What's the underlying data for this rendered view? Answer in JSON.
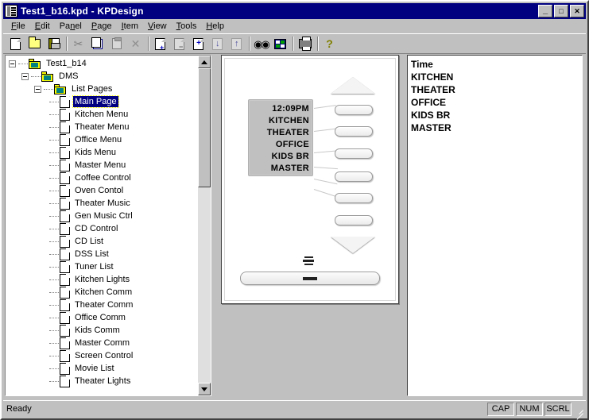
{
  "window": {
    "title": "Test1_b16.kpd - KPDesign",
    "icon": "application-icon",
    "minimize_label": "_",
    "maximize_label": "□",
    "close_label": "✕"
  },
  "menubar": {
    "items": [
      {
        "label": "File",
        "accel": "F"
      },
      {
        "label": "Edit",
        "accel": "E"
      },
      {
        "label": "Panel",
        "accel": "n"
      },
      {
        "label": "Page",
        "accel": "P"
      },
      {
        "label": "Item",
        "accel": "I"
      },
      {
        "label": "View",
        "accel": "V"
      },
      {
        "label": "Tools",
        "accel": "T"
      },
      {
        "label": "Help",
        "accel": "H"
      }
    ]
  },
  "toolbar": {
    "buttons": [
      {
        "name": "new-file-icon",
        "tip": "New"
      },
      {
        "name": "open-folder-icon",
        "tip": "Open"
      },
      {
        "name": "save-disk-icon",
        "tip": "Save"
      },
      {
        "name": "cut-scissors-icon",
        "tip": "Cut"
      },
      {
        "name": "copy-icon",
        "tip": "Copy"
      },
      {
        "name": "paste-clipboard-icon",
        "tip": "Paste"
      },
      {
        "name": "delete-x-icon",
        "tip": "Delete"
      },
      {
        "name": "add-page-icon",
        "tip": "Add Page"
      },
      {
        "name": "remove-page-icon",
        "tip": "Remove Page"
      },
      {
        "name": "new-page-plus-icon",
        "tip": "New Page"
      },
      {
        "name": "move-down-icon",
        "tip": "Move Down"
      },
      {
        "name": "move-up-icon",
        "tip": "Move Up"
      },
      {
        "name": "find-binoculars-icon",
        "tip": "Find"
      },
      {
        "name": "grid-icon",
        "tip": "Grid"
      },
      {
        "name": "print-icon",
        "tip": "Print"
      },
      {
        "name": "help-question-icon",
        "tip": "Help"
      }
    ]
  },
  "tree": {
    "root": {
      "label": "Test1_b14",
      "icon": "folder-icon",
      "expanded": true
    },
    "level2": {
      "label": "DMS",
      "icon": "folder-icon",
      "expanded": true
    },
    "level3": {
      "label": "List Pages",
      "icon": "folder-icon",
      "expanded": true
    },
    "pages": [
      {
        "label": "Main Page",
        "selected": true
      },
      {
        "label": "Kitchen Menu",
        "selected": false
      },
      {
        "label": "Theater Menu",
        "selected": false
      },
      {
        "label": "Office Menu",
        "selected": false
      },
      {
        "label": "Kids Menu",
        "selected": false
      },
      {
        "label": "Master Menu",
        "selected": false
      },
      {
        "label": "Coffee Control",
        "selected": false
      },
      {
        "label": "Oven Contol",
        "selected": false
      },
      {
        "label": "Theater Music",
        "selected": false
      },
      {
        "label": "Gen Music Ctrl",
        "selected": false
      },
      {
        "label": "CD Control",
        "selected": false
      },
      {
        "label": "CD List",
        "selected": false
      },
      {
        "label": "DSS List",
        "selected": false
      },
      {
        "label": "Tuner List",
        "selected": false
      },
      {
        "label": "Kitchen Lights",
        "selected": false
      },
      {
        "label": "Kitchen Comm",
        "selected": false
      },
      {
        "label": "Theater Comm",
        "selected": false
      },
      {
        "label": "Office Comm",
        "selected": false
      },
      {
        "label": "Kids Comm",
        "selected": false
      },
      {
        "label": "Master Comm",
        "selected": false
      },
      {
        "label": "Screen Control",
        "selected": false
      },
      {
        "label": "Movie List",
        "selected": false
      },
      {
        "label": "Theater Lights",
        "selected": false
      }
    ]
  },
  "design": {
    "lcd_lines": [
      "12:09PM",
      "KITCHEN",
      "THEATER",
      "OFFICE",
      "KIDS BR",
      "MASTER"
    ],
    "up_arrow": "scroll-up-triangle",
    "down_arrow": "scroll-down-triangle",
    "side_buttons": 6,
    "menu_icon": "hamburger-bars-icon",
    "bottom_bar": "wide-rocker-button"
  },
  "item_list": {
    "rows": [
      "Time",
      "KITCHEN",
      "THEATER",
      "OFFICE",
      "KIDS BR",
      "MASTER"
    ]
  },
  "statusbar": {
    "message": "Ready",
    "indicators": [
      "CAP",
      "NUM",
      "SCRL"
    ]
  },
  "colors": {
    "titlebar": "#000080",
    "face": "#c0c0c0",
    "selection": "#000080",
    "lcd": "#c0c0c0"
  }
}
